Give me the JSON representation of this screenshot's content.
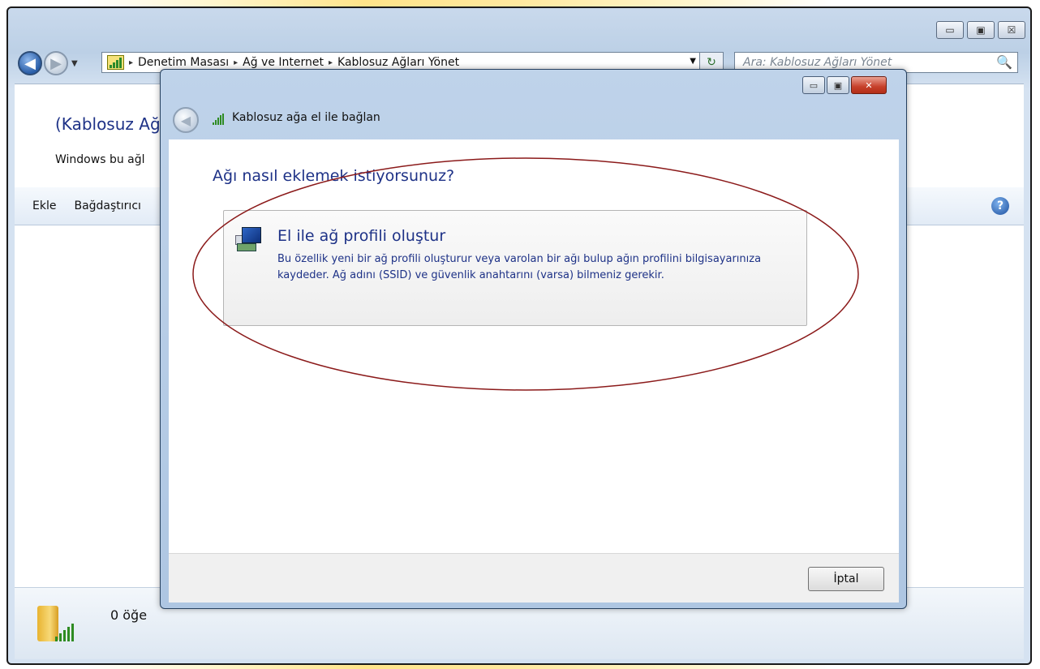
{
  "explorer": {
    "nav": {
      "back_glyph": "◀",
      "forward_glyph": "▶",
      "dropdown_glyph": "▼"
    },
    "breadcrumb": [
      "Denetim Masası",
      "Ağ ve Internet",
      "Kablosuz Ağları Yönet"
    ],
    "breadcrumb_sep": "▸",
    "address_dropdown": "▼",
    "refresh_glyph": "↻",
    "search_placeholder": "Ara: Kablosuz Ağları Yönet",
    "search_icon": "🔍",
    "caption_buttons": {
      "minimize": "▭",
      "maximize": "▣",
      "close": "☒"
    },
    "heading": "(Kablosuz Ağ",
    "subtext": "Windows bu ağl",
    "toolbar": {
      "add": "Ekle",
      "adapter": "Bağdaştırıcı",
      "help": "?"
    },
    "status": {
      "item_count": "0 öğe"
    }
  },
  "dialog": {
    "title": "Kablosuz ağa el ile bağlan",
    "caption_buttons": {
      "minimize": "▭",
      "maximize": "▣",
      "close": "✕"
    },
    "back_glyph": "◀",
    "question": "Ağı nasıl eklemek istiyorsunuz?",
    "option": {
      "title": "El ile ağ profili oluştur",
      "description": "Bu özellik yeni bir ağ profili oluşturur veya varolan bir ağı bulup ağın profilini bilgisayarınıza kaydeder. Ağ adını (SSID) ve güvenlik anahtarını (varsa) bilmeniz gerekir."
    },
    "cancel_label": "İptal"
  },
  "annotation_color": "#8b1a1a"
}
